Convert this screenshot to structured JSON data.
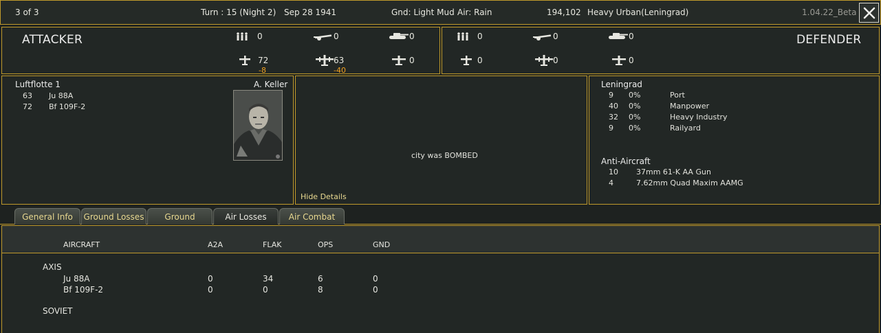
{
  "header": {
    "page_indicator": "3 of 3",
    "turn": "Turn : 15 (Night 2)",
    "date": "Sep 28 1941",
    "ground": "Gnd: Light Mud",
    "air": "Air: Rain",
    "hex_id": "194,102",
    "terrain": "Heavy Urban(Leningrad)",
    "version": "1.04.22_Beta"
  },
  "attacker": {
    "title": "ATTACKER",
    "infantry": "0",
    "artillery": "0",
    "tanks": "0",
    "fighters": "72",
    "fighters_loss": "-8",
    "bombers": "63",
    "bombers_loss": "-40",
    "recon": "0"
  },
  "defender": {
    "title": "DEFENDER",
    "infantry": "0",
    "artillery": "0",
    "tanks": "0",
    "fighters": "0",
    "bombers": "0",
    "recon": "0"
  },
  "leader_panel": {
    "unit_name": "Luftflotte 1",
    "commander": "A. Keller",
    "aircraft": [
      {
        "count": "63",
        "name": "Ju 88A"
      },
      {
        "count": "72",
        "name": "Bf 109F-2"
      }
    ]
  },
  "result": {
    "message": "city was BOMBED",
    "hide_details": "Hide Details"
  },
  "target": {
    "city": "Leningrad",
    "facilities": [
      {
        "value": "9",
        "pct": "0%",
        "name": "Port"
      },
      {
        "value": "40",
        "pct": "0%",
        "name": "Manpower"
      },
      {
        "value": "32",
        "pct": "0%",
        "name": "Heavy Industry"
      },
      {
        "value": "9",
        "pct": "0%",
        "name": "Railyard"
      }
    ],
    "aa_title": "Anti-Aircraft",
    "aa_units": [
      {
        "count": "10",
        "name": "37mm 61-K AA Gun"
      },
      {
        "count": "4",
        "name": "7.62mm Quad Maxim AAMG"
      }
    ]
  },
  "tabs": [
    {
      "label": "General Info"
    },
    {
      "label": "Ground Losses"
    },
    {
      "label": "Ground Combat"
    },
    {
      "label": "Air Losses"
    },
    {
      "label": "Air Combat"
    }
  ],
  "table": {
    "columns": [
      "AIRCRAFT",
      "A2A",
      "FLAK",
      "OPS",
      "GND"
    ],
    "axis_label": "AXIS",
    "rows": [
      {
        "aircraft": "Ju 88A",
        "a2a": "0",
        "flak": "34",
        "ops": "6",
        "gnd": "0"
      },
      {
        "aircraft": "Bf 109F-2",
        "a2a": "0",
        "flak": "0",
        "ops": "8",
        "gnd": "0"
      }
    ],
    "soviet_label": "SOVIET"
  },
  "colors": {
    "border_gold": "#c09a2c",
    "loss_orange": "#f0a020",
    "tab_text": "#e8d890",
    "background": "#222725"
  },
  "icons": [
    "infantry-icon",
    "artillery-icon",
    "tank-icon",
    "fighter-icon",
    "bomber-icon",
    "recon-plane-icon",
    "close-icon"
  ]
}
